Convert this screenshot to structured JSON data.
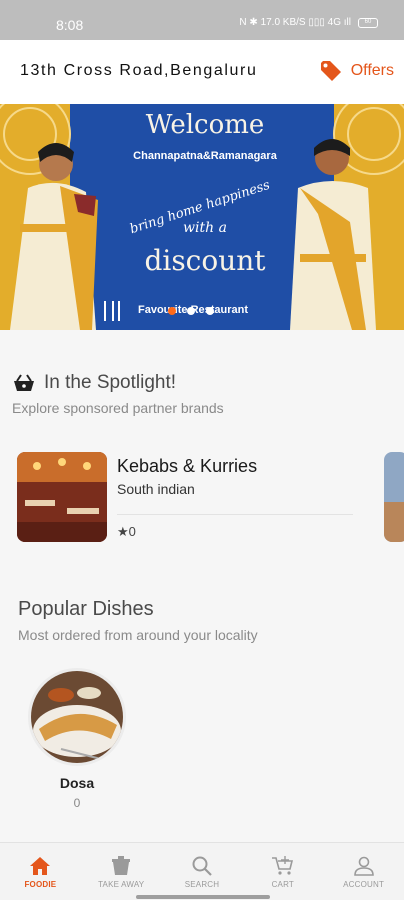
{
  "status_bar": {
    "time": "8:08",
    "indicators": "N ✱ 17.0 KB/S ▯▯▯ 4G ıll",
    "battery": "60"
  },
  "header": {
    "location": "13th Cross Road,Bengaluru",
    "offers_label": "Offers",
    "accent_color": "#e4561b"
  },
  "banner": {
    "welcome": "Welcome",
    "subtitle": "Channapatna&Ramanagara",
    "tagline_1": "bring home happiness",
    "tagline_2": "with a",
    "discount": "discount",
    "footer": "Favourite Restaurant",
    "slides_count": 4,
    "active_slide": 1
  },
  "spotlight": {
    "title": "In the Spotlight!",
    "subtitle": "Explore sponsored partner brands",
    "restaurant": {
      "name": "Kebabs & Kurries",
      "cuisine": "South indian",
      "rating": "★0"
    }
  },
  "popular": {
    "title": "Popular Dishes",
    "subtitle": "Most ordered from around your locality",
    "dishes": [
      {
        "name": "Dosa",
        "count": "0"
      }
    ]
  },
  "bottom_nav": {
    "items": [
      {
        "label": "FOODIE",
        "icon": "home-icon",
        "active": true
      },
      {
        "label": "TAKE AWAY",
        "icon": "takeaway-icon",
        "active": false
      },
      {
        "label": "SEARCH",
        "icon": "search-icon",
        "active": false
      },
      {
        "label": "CART",
        "icon": "cart-icon",
        "active": false
      },
      {
        "label": "ACCOUNT",
        "icon": "account-icon",
        "active": false
      }
    ]
  }
}
